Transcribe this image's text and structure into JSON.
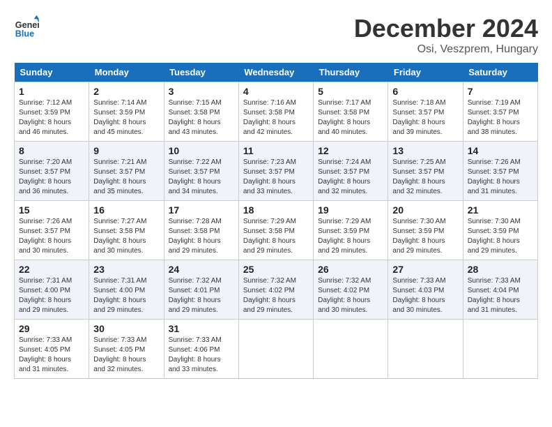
{
  "logo": {
    "line1": "General",
    "line2": "Blue"
  },
  "title": "December 2024",
  "location": "Osi, Veszprem, Hungary",
  "weekdays": [
    "Sunday",
    "Monday",
    "Tuesday",
    "Wednesday",
    "Thursday",
    "Friday",
    "Saturday"
  ],
  "weeks": [
    [
      {
        "day": "1",
        "sunrise": "7:12 AM",
        "sunset": "3:59 PM",
        "daylight": "8 hours and 46 minutes."
      },
      {
        "day": "2",
        "sunrise": "7:14 AM",
        "sunset": "3:59 PM",
        "daylight": "8 hours and 45 minutes."
      },
      {
        "day": "3",
        "sunrise": "7:15 AM",
        "sunset": "3:58 PM",
        "daylight": "8 hours and 43 minutes."
      },
      {
        "day": "4",
        "sunrise": "7:16 AM",
        "sunset": "3:58 PM",
        "daylight": "8 hours and 42 minutes."
      },
      {
        "day": "5",
        "sunrise": "7:17 AM",
        "sunset": "3:58 PM",
        "daylight": "8 hours and 40 minutes."
      },
      {
        "day": "6",
        "sunrise": "7:18 AM",
        "sunset": "3:57 PM",
        "daylight": "8 hours and 39 minutes."
      },
      {
        "day": "7",
        "sunrise": "7:19 AM",
        "sunset": "3:57 PM",
        "daylight": "8 hours and 38 minutes."
      }
    ],
    [
      {
        "day": "8",
        "sunrise": "7:20 AM",
        "sunset": "3:57 PM",
        "daylight": "8 hours and 36 minutes."
      },
      {
        "day": "9",
        "sunrise": "7:21 AM",
        "sunset": "3:57 PM",
        "daylight": "8 hours and 35 minutes."
      },
      {
        "day": "10",
        "sunrise": "7:22 AM",
        "sunset": "3:57 PM",
        "daylight": "8 hours and 34 minutes."
      },
      {
        "day": "11",
        "sunrise": "7:23 AM",
        "sunset": "3:57 PM",
        "daylight": "8 hours and 33 minutes."
      },
      {
        "day": "12",
        "sunrise": "7:24 AM",
        "sunset": "3:57 PM",
        "daylight": "8 hours and 32 minutes."
      },
      {
        "day": "13",
        "sunrise": "7:25 AM",
        "sunset": "3:57 PM",
        "daylight": "8 hours and 32 minutes."
      },
      {
        "day": "14",
        "sunrise": "7:26 AM",
        "sunset": "3:57 PM",
        "daylight": "8 hours and 31 minutes."
      }
    ],
    [
      {
        "day": "15",
        "sunrise": "7:26 AM",
        "sunset": "3:57 PM",
        "daylight": "8 hours and 30 minutes."
      },
      {
        "day": "16",
        "sunrise": "7:27 AM",
        "sunset": "3:58 PM",
        "daylight": "8 hours and 30 minutes."
      },
      {
        "day": "17",
        "sunrise": "7:28 AM",
        "sunset": "3:58 PM",
        "daylight": "8 hours and 29 minutes."
      },
      {
        "day": "18",
        "sunrise": "7:29 AM",
        "sunset": "3:58 PM",
        "daylight": "8 hours and 29 minutes."
      },
      {
        "day": "19",
        "sunrise": "7:29 AM",
        "sunset": "3:59 PM",
        "daylight": "8 hours and 29 minutes."
      },
      {
        "day": "20",
        "sunrise": "7:30 AM",
        "sunset": "3:59 PM",
        "daylight": "8 hours and 29 minutes."
      },
      {
        "day": "21",
        "sunrise": "7:30 AM",
        "sunset": "3:59 PM",
        "daylight": "8 hours and 29 minutes."
      }
    ],
    [
      {
        "day": "22",
        "sunrise": "7:31 AM",
        "sunset": "4:00 PM",
        "daylight": "8 hours and 29 minutes."
      },
      {
        "day": "23",
        "sunrise": "7:31 AM",
        "sunset": "4:00 PM",
        "daylight": "8 hours and 29 minutes."
      },
      {
        "day": "24",
        "sunrise": "7:32 AM",
        "sunset": "4:01 PM",
        "daylight": "8 hours and 29 minutes."
      },
      {
        "day": "25",
        "sunrise": "7:32 AM",
        "sunset": "4:02 PM",
        "daylight": "8 hours and 29 minutes."
      },
      {
        "day": "26",
        "sunrise": "7:32 AM",
        "sunset": "4:02 PM",
        "daylight": "8 hours and 30 minutes."
      },
      {
        "day": "27",
        "sunrise": "7:33 AM",
        "sunset": "4:03 PM",
        "daylight": "8 hours and 30 minutes."
      },
      {
        "day": "28",
        "sunrise": "7:33 AM",
        "sunset": "4:04 PM",
        "daylight": "8 hours and 31 minutes."
      }
    ],
    [
      {
        "day": "29",
        "sunrise": "7:33 AM",
        "sunset": "4:05 PM",
        "daylight": "8 hours and 31 minutes."
      },
      {
        "day": "30",
        "sunrise": "7:33 AM",
        "sunset": "4:05 PM",
        "daylight": "8 hours and 32 minutes."
      },
      {
        "day": "31",
        "sunrise": "7:33 AM",
        "sunset": "4:06 PM",
        "daylight": "8 hours and 33 minutes."
      },
      null,
      null,
      null,
      null
    ]
  ]
}
